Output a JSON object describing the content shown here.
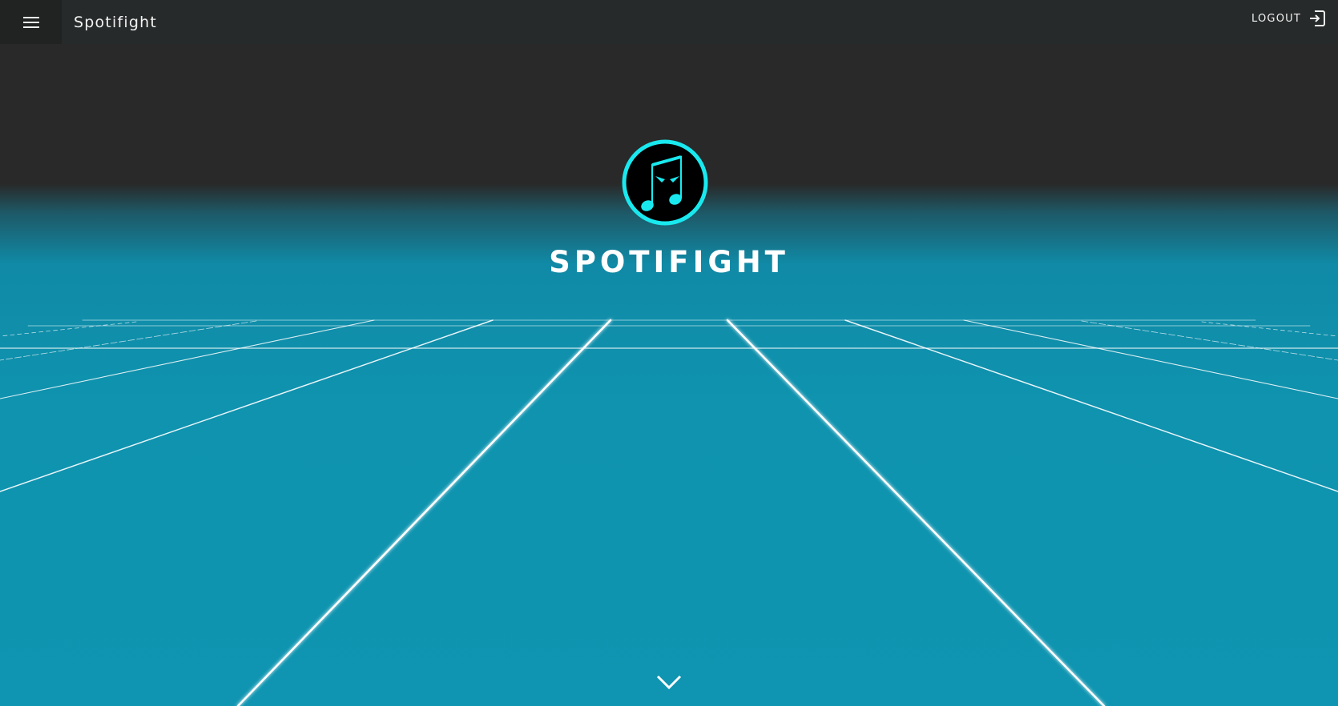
{
  "header": {
    "menu_icon": "hamburger-menu-icon",
    "app_name": "Spotifight",
    "logout_label": "LOGOUT",
    "logout_icon": "logout-icon"
  },
  "hero": {
    "logo_icon": "angry-music-note-logo",
    "title": "SPOTIFIGHT",
    "scroll_icon": "chevron-down-icon"
  },
  "colors": {
    "topbar": "#272a2a",
    "background_dark": "#292929",
    "background_teal": "#0f95b1",
    "accent_cyan": "#19e9ef",
    "grid_line": "#ffffff"
  }
}
